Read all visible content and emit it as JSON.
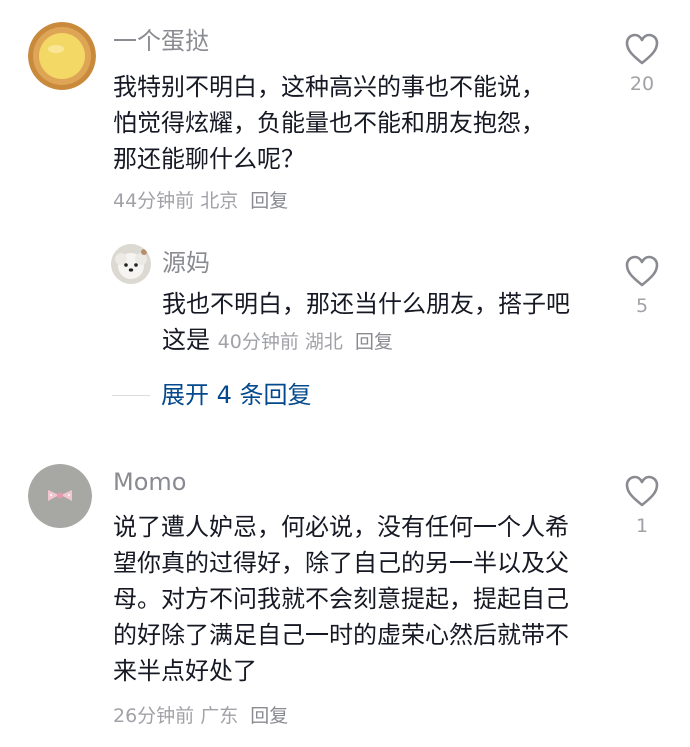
{
  "comments": [
    {
      "author": "一个蛋挞",
      "text": "我特别不明白，这种高兴的事也不能说，怕觉得炫耀，负能量也不能和朋友抱怨，那还能聊什么呢？",
      "time": "44分钟前",
      "location": "北京",
      "reply_label": "回复",
      "likes": "20",
      "avatar_icon": "egg-tart-avatar",
      "replies": [
        {
          "author": "源妈",
          "text": "我也不明白，那还当什么朋友，搭子吧这是",
          "time": "40分钟前",
          "location": "湖北",
          "reply_label": "回复",
          "likes": "5",
          "avatar_icon": "white-dog-avatar"
        }
      ],
      "expand_label": "展开 4 条回复"
    },
    {
      "author": "Momo",
      "text": "说了遭人妒忌，何必说，没有任何一个人希望你真的过得好，除了自己的另一半以及父母。对方不问我就不会刻意提起，提起自己的好除了满足自己一时的虚荣心然后就带不来半点好处了",
      "time": "26分钟前",
      "location": "广东",
      "reply_label": "回复",
      "likes": "1",
      "avatar_icon": "pink-bow-avatar"
    }
  ],
  "colors": {
    "text": "#161823",
    "muted": "#8a8b91",
    "meta": "#a1a2a7",
    "link": "#04498d",
    "like_icon": "#8a8b91"
  }
}
